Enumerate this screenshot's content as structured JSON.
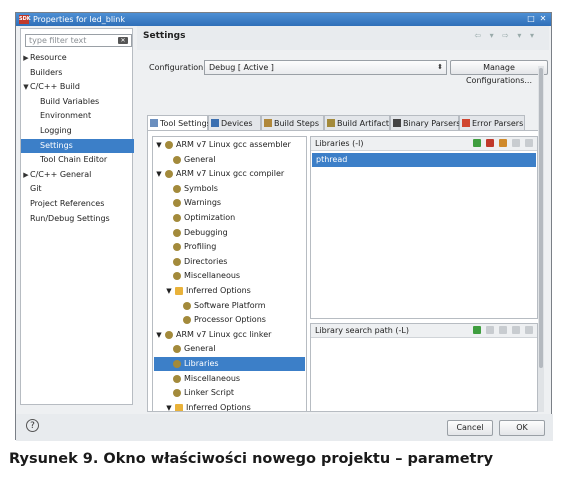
{
  "window": {
    "app_icon_text": "SDK",
    "title": "Properties for led_blink",
    "title_buttons": [
      "□",
      "✕"
    ]
  },
  "left_nav": {
    "filter_placeholder": "type filter text",
    "items": [
      {
        "label": "Resource",
        "expander": "▶",
        "level": 0
      },
      {
        "label": "Builders",
        "expander": "",
        "level": 0
      },
      {
        "label": "C/C++ Build",
        "expander": "▼",
        "level": 0
      },
      {
        "label": "Build Variables",
        "expander": "",
        "level": 1
      },
      {
        "label": "Environment",
        "expander": "",
        "level": 1
      },
      {
        "label": "Logging",
        "expander": "",
        "level": 1
      },
      {
        "label": "Settings",
        "expander": "",
        "level": 1,
        "selected": true
      },
      {
        "label": "Tool Chain Editor",
        "expander": "",
        "level": 1
      },
      {
        "label": "C/C++ General",
        "expander": "▶",
        "level": 0
      },
      {
        "label": "Git",
        "expander": "",
        "level": 0
      },
      {
        "label": "Project References",
        "expander": "",
        "level": 0
      },
      {
        "label": "Run/Debug Settings",
        "expander": "",
        "level": 0
      }
    ]
  },
  "header": {
    "title": "Settings",
    "nav_arrows": "⇦ ▾ ⇨ ▾ ▾"
  },
  "configuration": {
    "label": "Configuration:",
    "value": "Debug  [ Active ]",
    "caret": "⬍",
    "manage_button": "Manage Configurations..."
  },
  "tabs": [
    {
      "label": "Tool Settings",
      "active": true,
      "icon": "tool-settings-icon",
      "color": "#6b8fbf"
    },
    {
      "label": "Devices",
      "active": false,
      "icon": "devices-icon",
      "color": "#3b6fb0"
    },
    {
      "label": "Build Steps",
      "active": false,
      "icon": "build-steps-icon",
      "color": "#b0883b"
    },
    {
      "label": "Build Artifact",
      "active": false,
      "icon": "build-artifact-icon",
      "color": "#a38a3b"
    },
    {
      "label": "Binary Parsers",
      "active": false,
      "icon": "binary-parsers-icon",
      "color": "#444444"
    },
    {
      "label": "Error Parsers",
      "active": false,
      "icon": "error-parsers-icon",
      "color": "#d0452f"
    }
  ],
  "tool_tree": [
    {
      "label": "ARM v7 Linux gcc assembler",
      "level": 0,
      "expander": "▼",
      "icon": "tool-gear-icon"
    },
    {
      "label": "General",
      "level": 1,
      "expander": "",
      "icon": "options-icon"
    },
    {
      "label": "ARM v7 Linux gcc compiler",
      "level": 0,
      "expander": "▼",
      "icon": "tool-gear-icon"
    },
    {
      "label": "Symbols",
      "level": 1,
      "expander": "",
      "icon": "options-icon"
    },
    {
      "label": "Warnings",
      "level": 1,
      "expander": "",
      "icon": "options-icon"
    },
    {
      "label": "Optimization",
      "level": 1,
      "expander": "",
      "icon": "options-icon"
    },
    {
      "label": "Debugging",
      "level": 1,
      "expander": "",
      "icon": "options-icon"
    },
    {
      "label": "Profiling",
      "level": 1,
      "expander": "",
      "icon": "options-icon"
    },
    {
      "label": "Directories",
      "level": 1,
      "expander": "",
      "icon": "options-icon"
    },
    {
      "label": "Miscellaneous",
      "level": 1,
      "expander": "",
      "icon": "options-icon"
    },
    {
      "label": "Inferred Options",
      "level": 1,
      "expander": "▼",
      "icon": "folder-icon"
    },
    {
      "label": "Software Platform",
      "level": 2,
      "expander": "",
      "icon": "options-icon"
    },
    {
      "label": "Processor Options",
      "level": 2,
      "expander": "",
      "icon": "options-icon"
    },
    {
      "label": "ARM v7 Linux gcc linker",
      "level": 0,
      "expander": "▼",
      "icon": "tool-gear-icon"
    },
    {
      "label": "General",
      "level": 1,
      "expander": "",
      "icon": "options-icon"
    },
    {
      "label": "Libraries",
      "level": 1,
      "expander": "",
      "icon": "options-icon",
      "selected": true
    },
    {
      "label": "Miscellaneous",
      "level": 1,
      "expander": "",
      "icon": "options-icon"
    },
    {
      "label": "Linker Script",
      "level": 1,
      "expander": "",
      "icon": "options-icon"
    },
    {
      "label": "Inferred Options",
      "level": 1,
      "expander": "▼",
      "icon": "folder-icon"
    }
  ],
  "libraries_panel": {
    "title": "Libraries (-l)",
    "items": [
      "pthread"
    ],
    "toolbar_icons": [
      "add-icon",
      "delete-icon",
      "edit-icon",
      "move-up-icon",
      "move-down-icon"
    ]
  },
  "library_path_panel": {
    "title": "Library search path (-L)",
    "items": [],
    "toolbar_icons": [
      "add-icon",
      "delete-icon",
      "edit-icon",
      "move-up-icon",
      "move-down-icon"
    ]
  },
  "footer": {
    "help": "?",
    "cancel": "Cancel",
    "ok": "OK"
  },
  "caption": "Rysunek 9. Okno właściwości nowego projektu – parametry",
  "colors": {
    "selection": "#3c7fc8",
    "titlebar": "#2f6fb8",
    "icon_add": "#3f9e3f",
    "icon_delete": "#c0392b",
    "icon_edit": "#d08a2b",
    "icon_disabled": "#c8ccd0"
  }
}
